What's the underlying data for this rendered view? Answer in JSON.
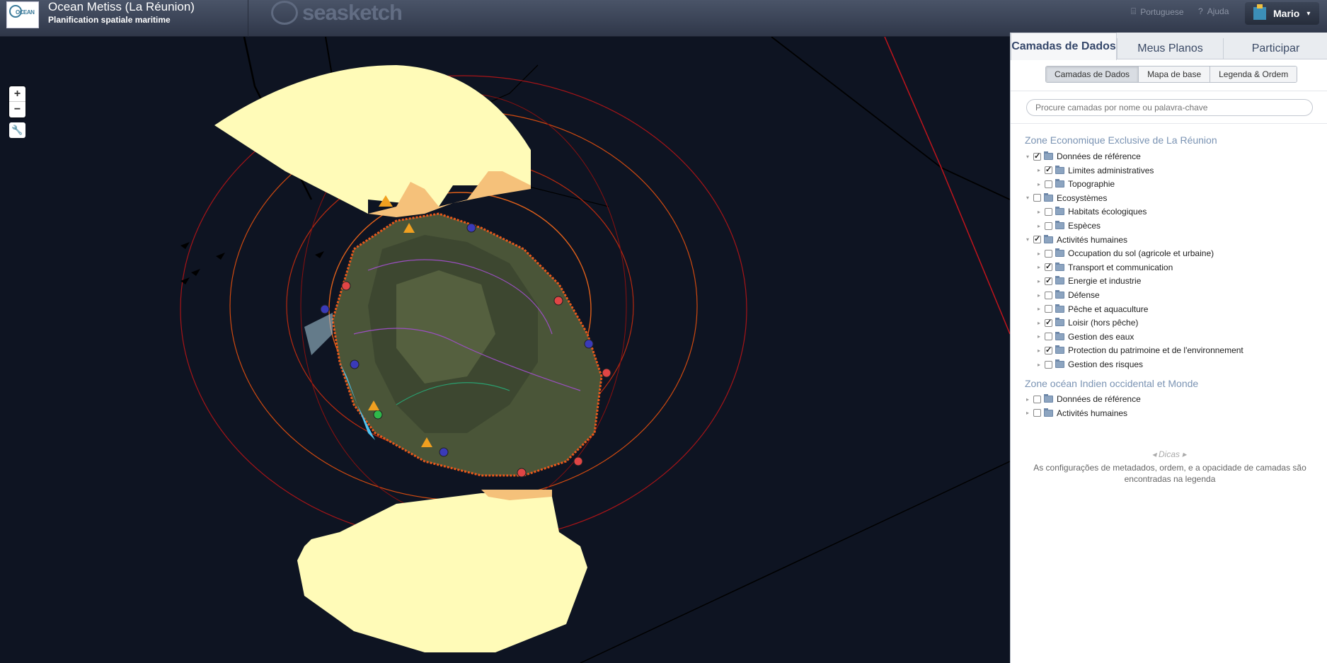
{
  "header": {
    "logo_text": "OCEAN",
    "project_title": "Ocean Metiss (La Réunion)",
    "project_subtitle": "Planification spatiale maritime",
    "brand": "seasketch",
    "language_link": "Portuguese",
    "help_link": "Ajuda",
    "user_name": "Mario",
    "user_caret": "▾"
  },
  "map_controls": {
    "zoom_in": "+",
    "zoom_out": "−",
    "tool": "🔧"
  },
  "panel": {
    "tabs": [
      {
        "label": "Camadas de Dados",
        "active": true
      },
      {
        "label": "Meus Planos"
      },
      {
        "label": "Participar"
      }
    ],
    "subtabs": [
      {
        "label": "Camadas de Dados",
        "active": true
      },
      {
        "label": "Mapa de base"
      },
      {
        "label": "Legenda & Ordem"
      }
    ],
    "search_placeholder": "Procure camadas por nome ou palavra-chave",
    "sections": [
      {
        "title": "Zone Economique Exclusive de La Réunion",
        "items": [
          {
            "label": "Données de référence",
            "level": 0,
            "checked": true,
            "expanded": true
          },
          {
            "label": "Limites administratives",
            "level": 1,
            "checked": true
          },
          {
            "label": "Topographie",
            "level": 1,
            "checked": false
          },
          {
            "label": "Ecosystèmes",
            "level": 0,
            "checked": false,
            "expanded": true
          },
          {
            "label": "Habitats écologiques",
            "level": 1,
            "checked": false
          },
          {
            "label": "Espèces",
            "level": 1,
            "checked": false
          },
          {
            "label": "Activités humaines",
            "level": 0,
            "checked": true,
            "expanded": true
          },
          {
            "label": "Occupation du sol (agricole et urbaine)",
            "level": 1,
            "checked": false
          },
          {
            "label": "Transport et communication",
            "level": 1,
            "checked": true
          },
          {
            "label": "Energie et industrie",
            "level": 1,
            "checked": true
          },
          {
            "label": "Défense",
            "level": 1,
            "checked": false
          },
          {
            "label": "Pêche et aquaculture",
            "level": 1,
            "checked": false
          },
          {
            "label": "Loisir (hors pêche)",
            "level": 1,
            "checked": true
          },
          {
            "label": "Gestion des eaux",
            "level": 1,
            "checked": false
          },
          {
            "label": "Protection du patrimoine et de l'environnement",
            "level": 1,
            "checked": true
          },
          {
            "label": "Gestion des risques",
            "level": 1,
            "checked": false
          }
        ]
      },
      {
        "title": "Zone océan Indien occidental et Monde",
        "items": [
          {
            "label": "Données de référence",
            "level": 0,
            "checked": false,
            "expanded": false
          },
          {
            "label": "Activités humaines",
            "level": 0,
            "checked": false,
            "expanded": false
          }
        ]
      }
    ],
    "tips_label": "Dicas",
    "tips_text": "As configurações de metadados, ordem, e a opacidade de camadas são encontradas na legenda"
  }
}
